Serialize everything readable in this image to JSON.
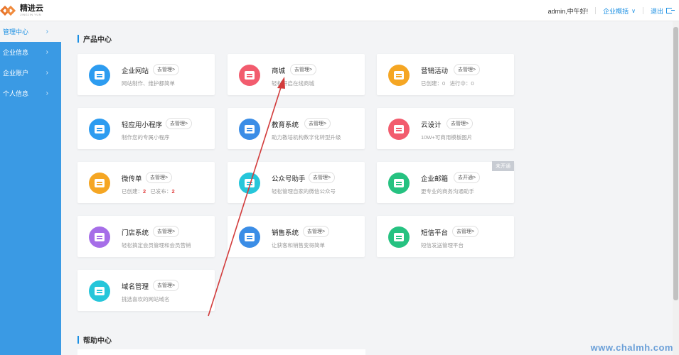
{
  "header": {
    "logo_name": "精进云",
    "logo_sub": "JINGJIN YUN",
    "greeting": "admin,中午好!",
    "overview_label": "企业概括",
    "logout_label": "退出"
  },
  "sidebar": {
    "items": [
      {
        "label": "管理中心"
      },
      {
        "label": "企业信息"
      },
      {
        "label": "企业账户"
      },
      {
        "label": "个人信息"
      }
    ]
  },
  "sections": {
    "products_title": "产品中心",
    "help_title": "帮助中心"
  },
  "cards": [
    {
      "name": "企业网站",
      "btn": "去管理>",
      "desc": "网站制作、维护都简单",
      "color": "#2d9cf0"
    },
    {
      "name": "商城",
      "btn": "去管理>",
      "desc": "轻松开启在线商城",
      "color": "#f25c6e"
    },
    {
      "name": "营销活动",
      "btn": "去管理>",
      "desc_a": "已创建：0",
      "desc_b": "进行中：0",
      "color": "#f5a623"
    },
    {
      "name": "轻应用小程序",
      "btn": "去管理>",
      "desc": "制作您的专属小程序",
      "color": "#2d9cf0"
    },
    {
      "name": "教育系统",
      "btn": "去管理>",
      "desc": "助力教培机构数字化转型升级",
      "color": "#3b8de6"
    },
    {
      "name": "云设计",
      "btn": "去管理>",
      "desc": "10W+可商用模板图片",
      "color": "#f25c6e"
    },
    {
      "name": "微传单",
      "btn": "去管理>",
      "desc_a": "已创建：",
      "num_a": "2",
      "desc_b": "已发布：",
      "num_b": "2",
      "color": "#f5a623"
    },
    {
      "name": "公众号助手",
      "btn": "去管理>",
      "desc": "轻松管理自家的微信公众号",
      "color": "#26c6da"
    },
    {
      "name": "企业邮箱",
      "btn": "去开通>",
      "desc": "更专业的商务沟通助手",
      "tag": "未开通",
      "color": "#26c281"
    },
    {
      "name": "门店系统",
      "btn": "去管理>",
      "desc": "轻松搞定会员管理和会员营销",
      "color": "#a66ee8"
    },
    {
      "name": "销售系统",
      "btn": "去管理>",
      "desc": "让获客和销售变得简单",
      "color": "#3b8de6"
    },
    {
      "name": "短信平台",
      "btn": "去管理>",
      "desc": "短信发送管理平台",
      "color": "#26c281"
    },
    {
      "name": "域名管理",
      "btn": "去管理>",
      "desc": "挑选喜欢的网站域名",
      "color": "#26c6da"
    }
  ],
  "watermark": "www.chalmh.com"
}
